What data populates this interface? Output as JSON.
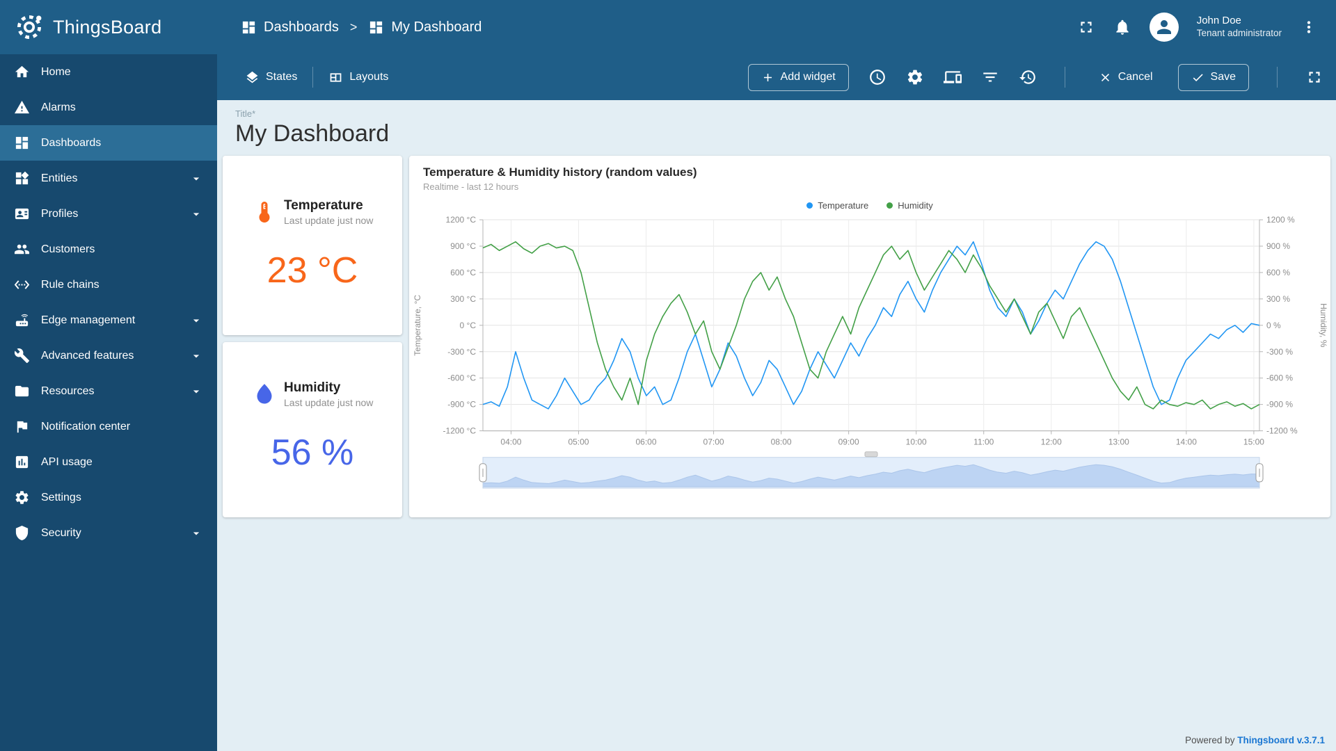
{
  "app": {
    "name": "ThingsBoard"
  },
  "header": {
    "breadcrumb": {
      "section": "Dashboards",
      "separator": ">",
      "current": "My Dashboard"
    },
    "user": {
      "name": "John Doe",
      "role": "Tenant administrator"
    }
  },
  "toolbar": {
    "states": "States",
    "layouts": "Layouts",
    "add_widget": "Add widget",
    "cancel": "Cancel",
    "save": "Save"
  },
  "title_field": {
    "label": "Title*",
    "value": "My Dashboard"
  },
  "sidebar": {
    "items": [
      {
        "label": "Home"
      },
      {
        "label": "Alarms"
      },
      {
        "label": "Dashboards",
        "selected": true
      },
      {
        "label": "Entities",
        "expandable": true
      },
      {
        "label": "Profiles",
        "expandable": true
      },
      {
        "label": "Customers"
      },
      {
        "label": "Rule chains"
      },
      {
        "label": "Edge management",
        "expandable": true
      },
      {
        "label": "Advanced features",
        "expandable": true
      },
      {
        "label": "Resources",
        "expandable": true
      },
      {
        "label": "Notification center"
      },
      {
        "label": "API usage"
      },
      {
        "label": "Settings"
      },
      {
        "label": "Security",
        "expandable": true
      }
    ]
  },
  "widgets": {
    "temperature": {
      "title": "Temperature",
      "subtitle": "Last update just now",
      "value": "23 °C",
      "accent": "#f8661a"
    },
    "humidity": {
      "title": "Humidity",
      "subtitle": "Last update just now",
      "value": "56 %",
      "accent": "#4766e8"
    }
  },
  "footer": {
    "powered_by": "Powered by",
    "version": "Thingsboard v.3.7.1"
  },
  "chart_data": {
    "type": "line",
    "title": "Temperature & Humidity history (random values)",
    "subtitle": "Realtime - last 12 hours",
    "legend_position": "top-center",
    "grid": true,
    "ylim": [
      -1200,
      1200
    ],
    "y_ticks": [
      1200,
      900,
      600,
      300,
      0,
      -300,
      -600,
      -900,
      -1200
    ],
    "y_left_label": "Temperature, °C",
    "y_right_label": "Humidity, %",
    "y_left_unit": "°C",
    "y_right_unit": "%",
    "x_time_range": [
      "03:35",
      "15:05"
    ],
    "x_ticks": [
      "04:00",
      "05:00",
      "06:00",
      "07:00",
      "08:00",
      "09:00",
      "10:00",
      "11:00",
      "12:00",
      "13:00",
      "14:00",
      "15:00"
    ],
    "series": [
      {
        "name": "Temperature",
        "color": "#2196f3",
        "values": [
          -900,
          -870,
          -920,
          -700,
          -300,
          -600,
          -850,
          -900,
          -950,
          -800,
          -600,
          -750,
          -900,
          -850,
          -700,
          -600,
          -400,
          -150,
          -300,
          -600,
          -800,
          -700,
          -900,
          -850,
          -600,
          -300,
          -100,
          -400,
          -700,
          -500,
          -200,
          -350,
          -600,
          -800,
          -650,
          -400,
          -500,
          -700,
          -900,
          -750,
          -500,
          -300,
          -450,
          -600,
          -400,
          -200,
          -350,
          -150,
          0,
          200,
          100,
          350,
          500,
          300,
          150,
          400,
          600,
          750,
          900,
          800,
          950,
          700,
          400,
          200,
          100,
          300,
          150,
          -100,
          50,
          250,
          400,
          300,
          500,
          700,
          850,
          950,
          900,
          750,
          500,
          200,
          -100,
          -400,
          -700,
          -900,
          -850,
          -600,
          -400,
          -300,
          -200,
          -100,
          -150,
          -50,
          0,
          -80,
          20,
          0
        ]
      },
      {
        "name": "Humidity",
        "color": "#43a047",
        "values": [
          880,
          920,
          850,
          900,
          950,
          870,
          820,
          900,
          930,
          880,
          900,
          850,
          600,
          200,
          -200,
          -500,
          -700,
          -850,
          -600,
          -900,
          -400,
          -100,
          100,
          250,
          350,
          150,
          -100,
          50,
          -300,
          -500,
          -250,
          0,
          300,
          500,
          600,
          400,
          550,
          300,
          100,
          -200,
          -500,
          -600,
          -300,
          -100,
          100,
          -100,
          200,
          400,
          600,
          800,
          900,
          750,
          850,
          600,
          400,
          550,
          700,
          850,
          750,
          600,
          800,
          650,
          450,
          300,
          150,
          300,
          100,
          -100,
          150,
          250,
          50,
          -150,
          100,
          200,
          0,
          -200,
          -400,
          -600,
          -750,
          -850,
          -700,
          -900,
          -950,
          -850,
          -900,
          -920,
          -880,
          -900,
          -850,
          -950,
          -900,
          -870,
          -920,
          -890,
          -950,
          -900
        ]
      }
    ]
  }
}
